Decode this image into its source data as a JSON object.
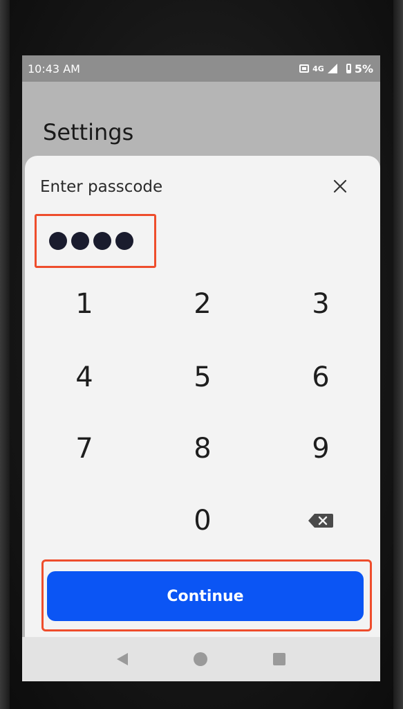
{
  "status_bar": {
    "time": "10:43 AM",
    "network": "4G",
    "battery": "5%",
    "icons": [
      "sim-icon",
      "signal-icon",
      "battery-icon"
    ]
  },
  "app": {
    "title": "Settings"
  },
  "passcode_sheet": {
    "title": "Enter passcode",
    "close_icon": "close-icon",
    "entered_digits": 4,
    "keypad": {
      "k1": "1",
      "k2": "2",
      "k3": "3",
      "k4": "4",
      "k5": "5",
      "k6": "6",
      "k7": "7",
      "k8": "8",
      "k9": "9",
      "k0": "0"
    },
    "backspace_icon": "backspace-icon",
    "continue_label": "Continue"
  },
  "nav_bar": {
    "icons": [
      "back-icon",
      "home-icon",
      "recents-icon"
    ]
  },
  "colors": {
    "accent": "#0b55f4",
    "highlight": "#ee4d2c",
    "dot": "#1a1c2e"
  }
}
